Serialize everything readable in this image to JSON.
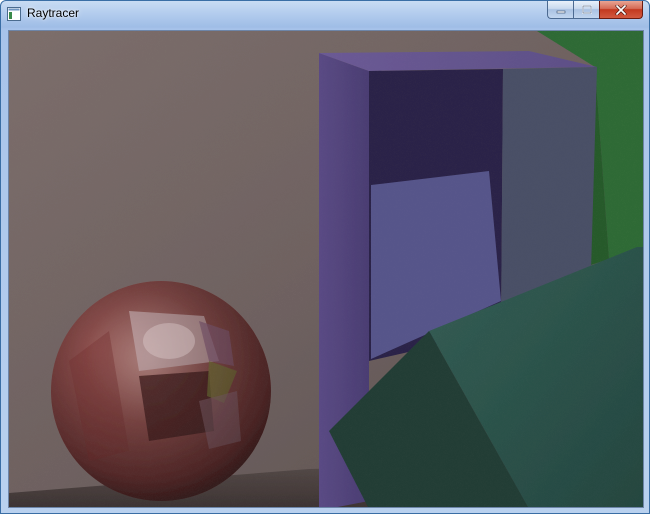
{
  "window": {
    "title": "Raytracer",
    "icon": "app-window-icon",
    "controls": {
      "minimize": "minimize-icon",
      "maximize": "maximize-icon",
      "close": "close-icon"
    }
  },
  "render": {
    "description_colors": {
      "wall": "#6f6260",
      "floor": "#4e4341",
      "box_purple": "#5b4a86",
      "box_teal": "#2f5d52",
      "box_green": "#2f6b36",
      "sphere_red": "#7a3a3a"
    }
  }
}
